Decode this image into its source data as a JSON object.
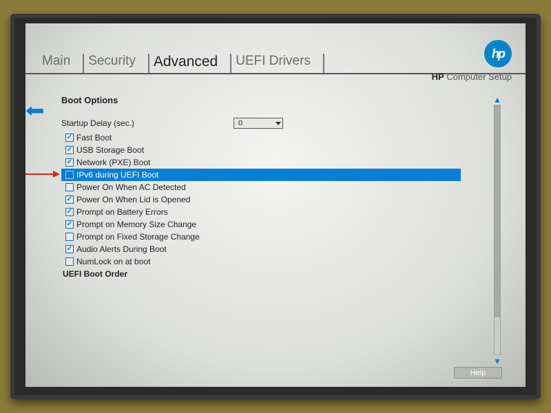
{
  "tabs": {
    "main": "Main",
    "security": "Security",
    "advanced": "Advanced",
    "uefi": "UEFI Drivers",
    "active": "advanced"
  },
  "branding": {
    "logo_text": "hp",
    "subtitle_bold": "HP",
    "subtitle_rest": " Computer Setup"
  },
  "section_title": "Boot Options",
  "startup_delay": {
    "label": "Startup Delay (sec.)",
    "value": "0"
  },
  "items": [
    {
      "label": "Fast Boot",
      "checked": true
    },
    {
      "label": "USB Storage Boot",
      "checked": true
    },
    {
      "label": "Network (PXE) Boot",
      "checked": true
    },
    {
      "label": "IPv6 during UEFI Boot",
      "checked": false,
      "highlight": true
    },
    {
      "label": "Power On When AC Detected",
      "checked": false
    },
    {
      "label": "Power On When Lid is Opened",
      "checked": true
    },
    {
      "label": "Prompt on Battery Errors",
      "checked": true
    },
    {
      "label": "Prompt on Memory Size Change",
      "checked": true
    },
    {
      "label": "Prompt on Fixed Storage Change",
      "checked": false
    },
    {
      "label": "Audio Alerts During Boot",
      "checked": true
    },
    {
      "label": "NumLock on at boot",
      "checked": false
    }
  ],
  "footer_item": "UEFI Boot Order",
  "help_label": "Help"
}
